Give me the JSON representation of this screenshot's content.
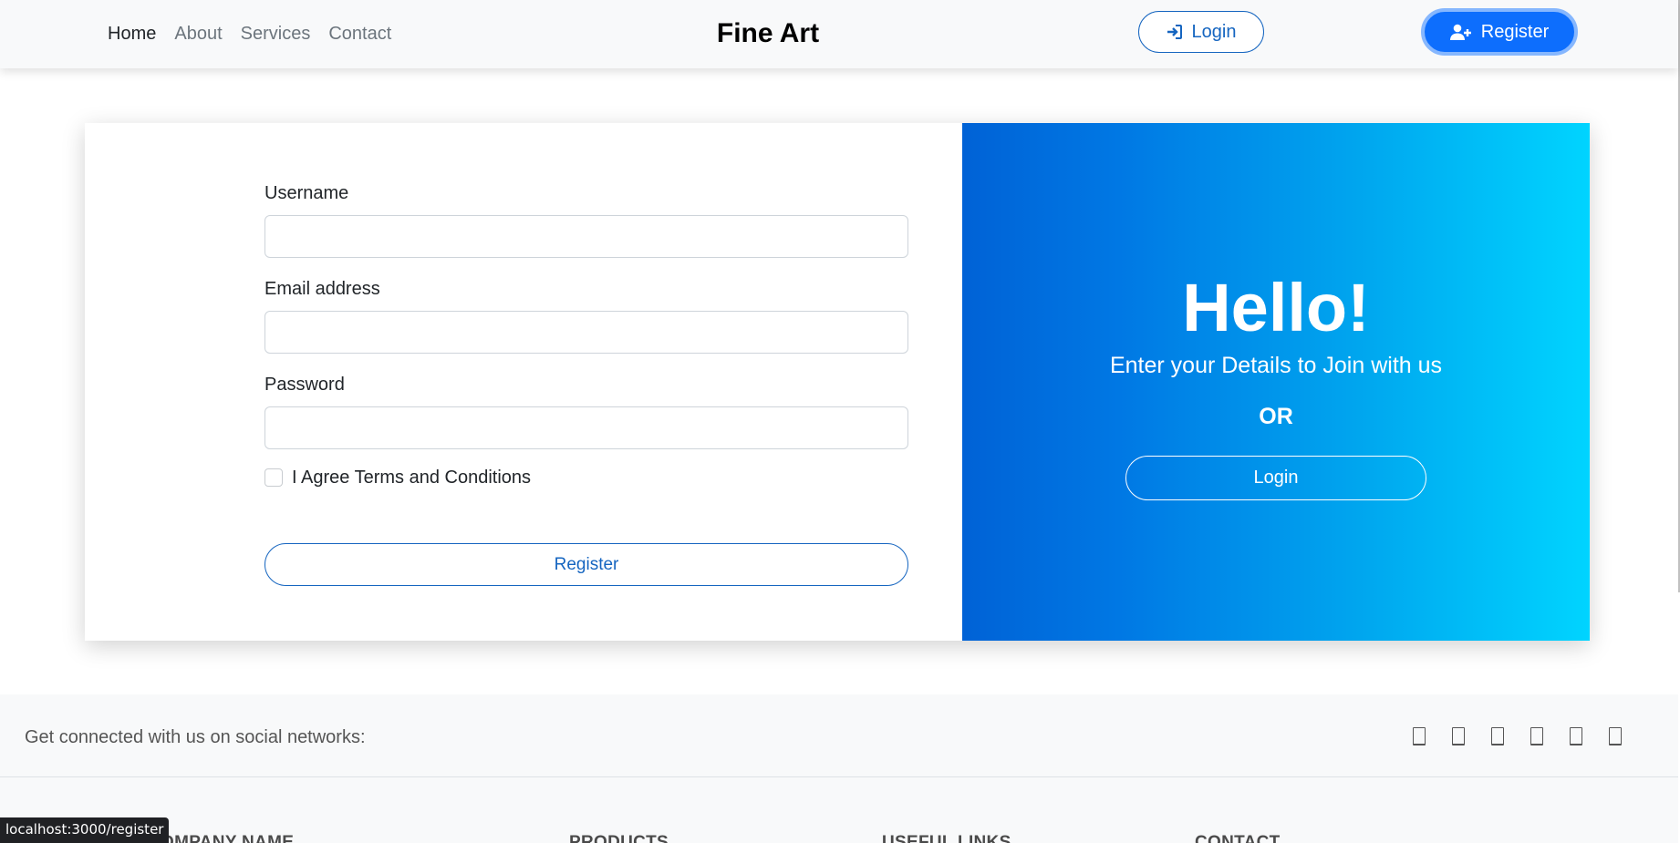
{
  "nav": {
    "links": [
      {
        "label": "Home"
      },
      {
        "label": "About"
      },
      {
        "label": "Services"
      },
      {
        "label": "Contact"
      }
    ],
    "brand": "Fine Art",
    "login_label": "Login",
    "register_label": "Register",
    "login_icon": "sign-in-icon",
    "register_icon": "user-plus-icon"
  },
  "form": {
    "username_label": "Username",
    "username_value": "",
    "email_label": "Email address",
    "email_value": "",
    "password_label": "Password",
    "password_value": "",
    "terms_label": "I Agree Terms and Conditions",
    "terms_checked": false,
    "submit_label": "Register"
  },
  "promo": {
    "title": "Hello!",
    "subtitle": "Enter your Details to Join with us",
    "or_text": "OR",
    "login_label": "Login"
  },
  "footer": {
    "social_text": "Get connected with us on social networks:",
    "social_icons": [
      "social-icon-1",
      "social-icon-2",
      "social-icon-3",
      "social-icon-4",
      "social-icon-5",
      "social-icon-6"
    ],
    "headings": [
      "COMPANY NAME",
      "PRODUCTS",
      "USEFUL LINKS",
      "CONTACT"
    ]
  },
  "status_url": "localhost:3000/register",
  "colors": {
    "primary": "#0d6efd",
    "outline": "#1565c0",
    "promo_gradient_start": "#0062d6",
    "promo_gradient_end": "#00d4ff"
  }
}
